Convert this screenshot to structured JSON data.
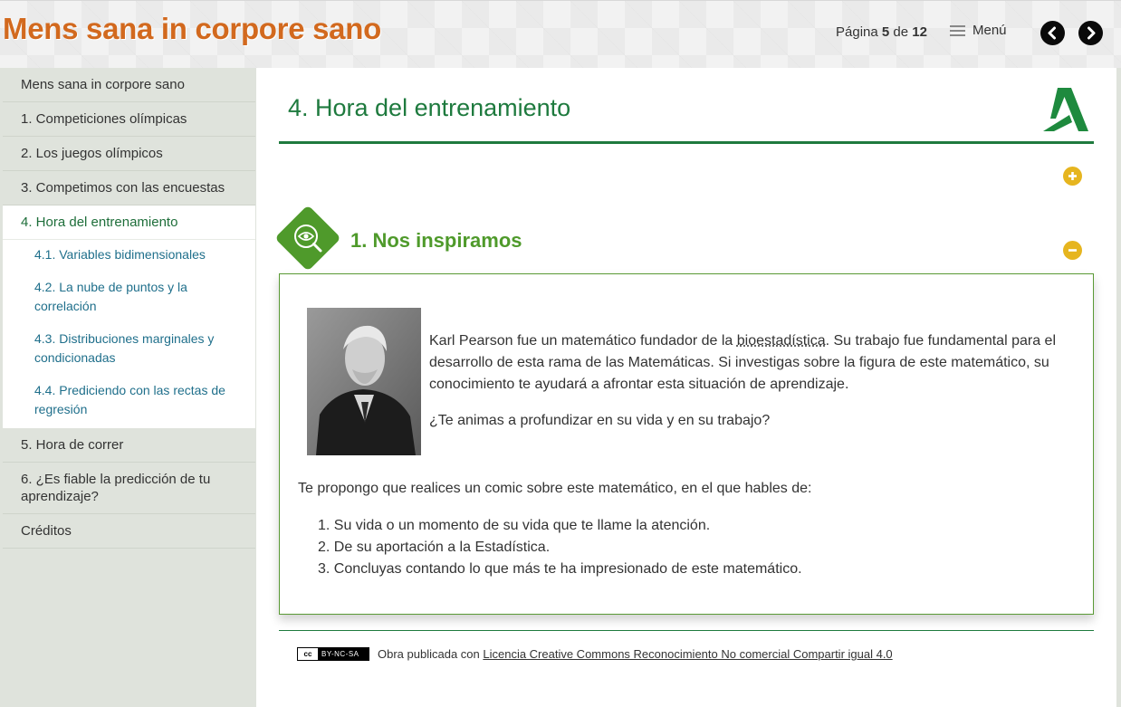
{
  "header": {
    "site_title": "Mens sana in corpore sano",
    "page_prefix": "Página",
    "page_current": "5",
    "page_of": "de",
    "page_total": "12",
    "menu_label": "Menú"
  },
  "sidebar": {
    "items": [
      {
        "label": "Mens sana in corpore sano"
      },
      {
        "label": "1. Competiciones olímpicas"
      },
      {
        "label": "2. Los juegos olímpicos"
      },
      {
        "label": "3. Competimos con las encuestas"
      },
      {
        "label": "4. Hora del entrenamiento",
        "active": true
      },
      {
        "label": "5. Hora de correr"
      },
      {
        "label": "6. ¿Es fiable la predicción de tu aprendizaje?"
      },
      {
        "label": "Créditos"
      }
    ],
    "subitems": [
      {
        "label": "4.1. Variables bidimensionales"
      },
      {
        "label": "4.2. La nube de puntos y la correlación"
      },
      {
        "label": "4.3. Distribuciones marginales y condicionadas"
      },
      {
        "label": "4.4. Prediciendo con las rectas de regresión"
      }
    ]
  },
  "main": {
    "title": "4. Hora del entrenamiento",
    "section_title": "1. Nos inspiramos",
    "intro_before": "Karl Pearson fue un matemático fundador de la ",
    "intro_term": "bioestadística",
    "intro_after": ". Su trabajo fue fundamental para el desarrollo de esta rama de las Matemáticas. Si investigas sobre la figura de este matemático, su conocimiento te ayudará a afrontar esta situación de aprendizaje.",
    "question": "¿Te animas a profundizar en su vida y en su trabajo?",
    "task": "Te propongo que realices un comic sobre este matemático, en el que hables de:",
    "task_list": [
      "1. Su vida o un momento de su vida que te llame la atención.",
      "2. De su aportación a la Estadística.",
      "3. Concluyas contando lo que más te ha impresionado de este matemático."
    ]
  },
  "footer": {
    "badge_cc": "cc",
    "badge_terms": "BY-NC-SA",
    "license_prefix": "Obra publicada con ",
    "license_link": "Licencia Creative Commons Reconocimiento No comercial Compartir igual 4.0"
  },
  "colors": {
    "brand_orange": "#d2691e",
    "brand_green": "#1e7a3e",
    "section_green": "#4f9a2b",
    "accent_yellow": "#e6b51f",
    "link_blue": "#1f6f8b"
  },
  "icons": {
    "prev": "chevron-left-icon",
    "next": "chevron-right-icon",
    "menu": "hamburger-icon",
    "expand": "plus-circle-icon",
    "collapse": "minus-circle-icon",
    "section": "magnifier-eye-icon",
    "logo": "junta-andalucia-logo"
  }
}
